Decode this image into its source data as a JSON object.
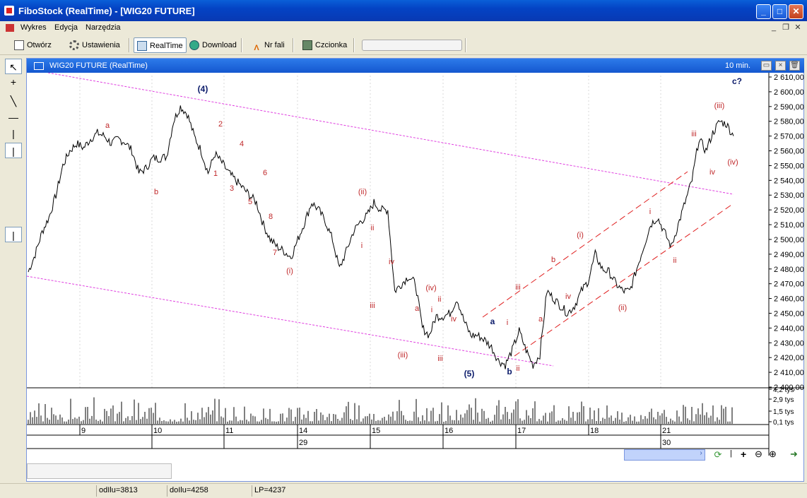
{
  "window": {
    "title": "FiboStock (RealTime) - [WIG20 FUTURE]"
  },
  "menu": [
    "Wykres",
    "Edycja",
    "Narzędzia"
  ],
  "toolbar": {
    "open": "Otwórz",
    "settings": "Ustawienia",
    "realtime": "RealTime",
    "download": "Download",
    "nrfali": "Nr fali",
    "font": "Czcionka"
  },
  "chart": {
    "title": "WIG20 FUTURE (RealTime)",
    "interval": "10 min."
  },
  "chart_data": {
    "type": "line",
    "title": "WIG20 FUTURE (RealTime)",
    "ylim": [
      2400,
      2610
    ],
    "y_ticks": [
      "2 610,00",
      "2 600,00",
      "2 590,00",
      "2 580,00",
      "2 570,00",
      "2 560,00",
      "2 550,00",
      "2 540,00",
      "2 530,00",
      "2 520,00",
      "2 510,00",
      "2 500,00",
      "2 490,00",
      "2 480,00",
      "2 470,00",
      "2 460,00",
      "2 450,00",
      "2 440,00",
      "2 430,00",
      "2 420,00",
      "2 410,00",
      "2 400,00"
    ],
    "x_day_labels": [
      "9",
      "10",
      "11",
      "14",
      "15",
      "16",
      "17",
      "18",
      "21"
    ],
    "x_week_labels": [
      "29",
      "30"
    ],
    "volume_ticks": [
      "4,2 tys",
      "2,9 tys",
      "1,5 tys",
      "0,1 tys"
    ],
    "price": [
      2478,
      2490,
      2505,
      2515,
      2530,
      2550,
      2560,
      2565,
      2562,
      2568,
      2572,
      2570,
      2565,
      2568,
      2566,
      2560,
      2545,
      2548,
      2555,
      2555,
      2556,
      2580,
      2590,
      2585,
      2570,
      2560,
      2545,
      2558,
      2552,
      2545,
      2540,
      2535,
      2530,
      2525,
      2510,
      2500,
      2495,
      2492,
      2488,
      2500,
      2512,
      2525,
      2520,
      2512,
      2500,
      2480,
      2492,
      2505,
      2512,
      2516,
      2525,
      2520,
      2520,
      2465,
      2470,
      2475,
      2470,
      2440,
      2435,
      2448,
      2448,
      2450,
      2460,
      2445,
      2435,
      2435,
      2432,
      2427,
      2418,
      2415,
      2425,
      2438,
      2425,
      2415,
      2422,
      2465,
      2460,
      2455,
      2450,
      2455,
      2465,
      2472,
      2490,
      2480,
      2478,
      2470,
      2465,
      2465,
      2480,
      2495,
      2510,
      2515,
      2505,
      2495,
      2510,
      2525,
      2540,
      2568,
      2560,
      2572,
      2580,
      2578,
      2570
    ],
    "wave_labels": [
      "a",
      "b",
      "(4)",
      "1",
      "2",
      "3",
      "4",
      "5",
      "6",
      "7",
      "8",
      "(i)",
      "(ii)",
      "i",
      "ii",
      "iii",
      "iv",
      "(iii)",
      "a",
      "i",
      "(iv)",
      "ii",
      "iii",
      "iv",
      "(5)",
      "a",
      "b",
      "i",
      "ii",
      "iii",
      "a",
      "b",
      "iv",
      "(i)",
      "(ii)",
      "i",
      "ii",
      "iii",
      "iv",
      "(iii)",
      "(iv)",
      "c?"
    ]
  },
  "status": {
    "od": "odIlu=3813",
    "do": "doIlu=4258",
    "lp": "LP=4237"
  }
}
